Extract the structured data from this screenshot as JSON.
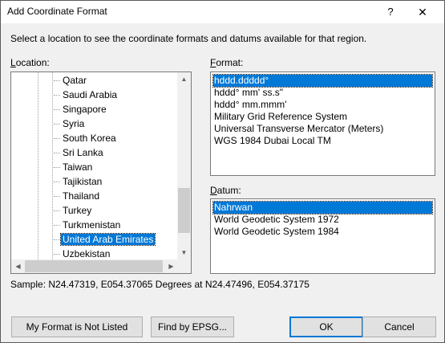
{
  "window": {
    "title": "Add Coordinate Format",
    "help_label": "?",
    "close_label": "✕"
  },
  "instructions": "Select a location to see the coordinate formats and datums available for that region.",
  "location": {
    "label_underline": "L",
    "label_rest": "ocation:",
    "items": [
      {
        "label": "Qatar",
        "selected": false
      },
      {
        "label": "Saudi Arabia",
        "selected": false
      },
      {
        "label": "Singapore",
        "selected": false
      },
      {
        "label": "Syria",
        "selected": false
      },
      {
        "label": "South Korea",
        "selected": false
      },
      {
        "label": "Sri Lanka",
        "selected": false
      },
      {
        "label": "Taiwan",
        "selected": false
      },
      {
        "label": "Tajikistan",
        "selected": false
      },
      {
        "label": "Thailand",
        "selected": false
      },
      {
        "label": "Turkey",
        "selected": false
      },
      {
        "label": "Turkmenistan",
        "selected": false
      },
      {
        "label": "United Arab Emirates",
        "selected": true
      },
      {
        "label": "Uzbekistan",
        "selected": false
      }
    ]
  },
  "format": {
    "label_underline": "F",
    "label_rest": "ormat:",
    "items": [
      {
        "label": "hddd.ddddd°",
        "selected": true
      },
      {
        "label": "hddd° mm' ss.s\"",
        "selected": false
      },
      {
        "label": "hddd° mm.mmm'",
        "selected": false
      },
      {
        "label": "Military Grid Reference System",
        "selected": false
      },
      {
        "label": "Universal Transverse Mercator (Meters)",
        "selected": false
      },
      {
        "label": "WGS 1984 Dubai Local TM",
        "selected": false
      }
    ]
  },
  "datum": {
    "label_underline": "D",
    "label_rest": "atum:",
    "items": [
      {
        "label": "Nahrwan",
        "selected": true
      },
      {
        "label": "World Geodetic System 1972",
        "selected": false
      },
      {
        "label": "World Geodetic System 1984",
        "selected": false
      }
    ]
  },
  "sample": "Sample: N24.47319, E054.37065 Degrees at N24.47496, E054.37175",
  "buttons": {
    "not_listed": "My Format is Not Listed",
    "find_epsg": "Find by EPSG...",
    "ok": "OK",
    "cancel": "Cancel"
  }
}
